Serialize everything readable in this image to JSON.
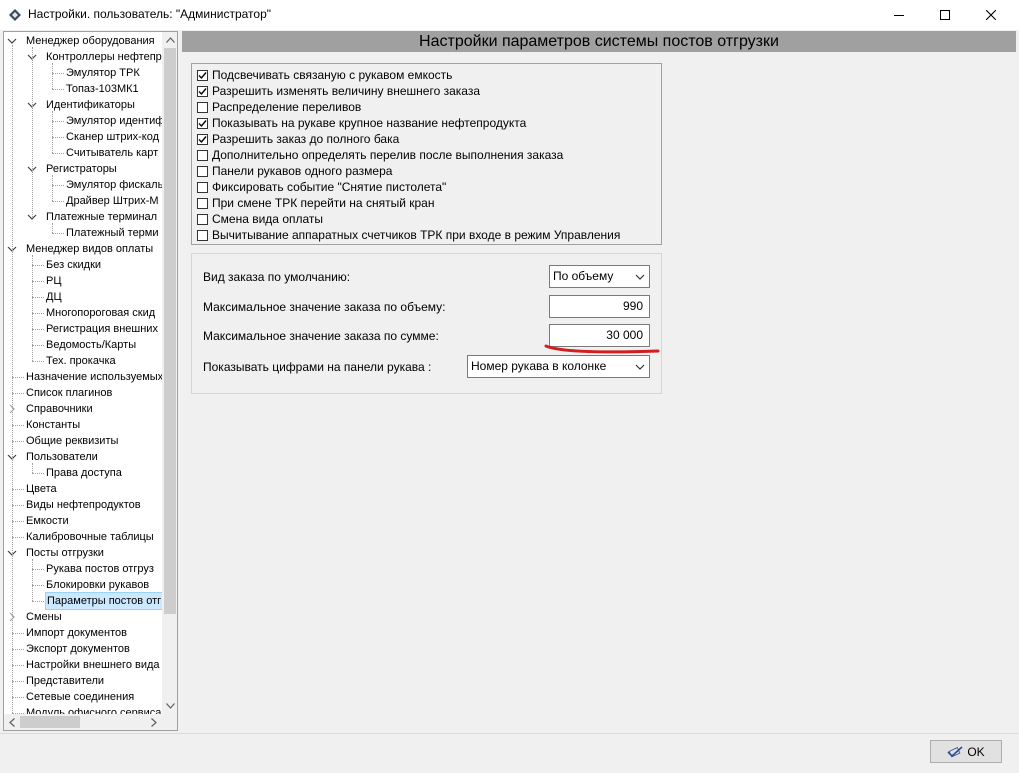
{
  "window": {
    "title": "Настройки. пользователь: \"Администратор\""
  },
  "tree": {
    "items": [
      {
        "label": "Менеджер оборудования",
        "level": 0,
        "expander": "expanded"
      },
      {
        "label": "Контроллеры нефтепр",
        "level": 1,
        "expander": "expanded"
      },
      {
        "label": "Эмулятор ТРК",
        "level": 2,
        "expander": "none"
      },
      {
        "label": "Топаз-103МК1",
        "level": 2,
        "expander": "none"
      },
      {
        "label": "Идентификаторы",
        "level": 1,
        "expander": "expanded"
      },
      {
        "label": "Эмулятор идентиф",
        "level": 2,
        "expander": "none"
      },
      {
        "label": "Сканер штрих-код",
        "level": 2,
        "expander": "none"
      },
      {
        "label": "Считыватель карт",
        "level": 2,
        "expander": "none"
      },
      {
        "label": "Регистраторы",
        "level": 1,
        "expander": "expanded"
      },
      {
        "label": "Эмулятор фискаль",
        "level": 2,
        "expander": "none"
      },
      {
        "label": "Драйвер Штрих-М",
        "level": 2,
        "expander": "none"
      },
      {
        "label": "Платежные терминал",
        "level": 1,
        "expander": "expanded"
      },
      {
        "label": "Платежный терми",
        "level": 2,
        "expander": "none"
      },
      {
        "label": "Менеджер видов оплаты",
        "level": 0,
        "expander": "expanded"
      },
      {
        "label": "Без скидки",
        "level": 1,
        "expander": "none"
      },
      {
        "label": "РЦ",
        "level": 1,
        "expander": "none"
      },
      {
        "label": "ДЦ",
        "level": 1,
        "expander": "none"
      },
      {
        "label": "Многопороговая скид",
        "level": 1,
        "expander": "none"
      },
      {
        "label": "Регистрация внешних",
        "level": 1,
        "expander": "none"
      },
      {
        "label": "Ведомость/Карты",
        "level": 1,
        "expander": "none"
      },
      {
        "label": "Тех. прокачка",
        "level": 1,
        "expander": "none"
      },
      {
        "label": "Назначение используемых",
        "level": 0,
        "expander": "none"
      },
      {
        "label": "Список плагинов",
        "level": 0,
        "expander": "none"
      },
      {
        "label": "Справочники",
        "level": 0,
        "expander": "collapsed"
      },
      {
        "label": "Константы",
        "level": 0,
        "expander": "none"
      },
      {
        "label": "Общие реквизиты",
        "level": 0,
        "expander": "none"
      },
      {
        "label": "Пользователи",
        "level": 0,
        "expander": "expanded"
      },
      {
        "label": "Права доступа",
        "level": 1,
        "expander": "none"
      },
      {
        "label": "Цвета",
        "level": 0,
        "expander": "none"
      },
      {
        "label": "Виды нефтепродуктов",
        "level": 0,
        "expander": "none"
      },
      {
        "label": "Емкости",
        "level": 0,
        "expander": "none"
      },
      {
        "label": "Калибровочные таблицы",
        "level": 0,
        "expander": "none"
      },
      {
        "label": "Посты отгрузки",
        "level": 0,
        "expander": "expanded"
      },
      {
        "label": "Рукава постов отгруз",
        "level": 1,
        "expander": "none"
      },
      {
        "label": "Блокировки рукавов",
        "level": 1,
        "expander": "none"
      },
      {
        "label": "Параметры постов отг",
        "level": 1,
        "expander": "none",
        "selected": true
      },
      {
        "label": "Смены",
        "level": 0,
        "expander": "collapsed"
      },
      {
        "label": "Импорт документов",
        "level": 0,
        "expander": "none"
      },
      {
        "label": "Экспорт документов",
        "level": 0,
        "expander": "none"
      },
      {
        "label": "Настройки внешнего вида",
        "level": 0,
        "expander": "none"
      },
      {
        "label": "Представители",
        "level": 0,
        "expander": "none"
      },
      {
        "label": "Сетевые соединения",
        "level": 0,
        "expander": "none"
      },
      {
        "label": "Модуль офисного сервиса",
        "level": 0,
        "expander": "none"
      }
    ]
  },
  "page": {
    "title": "Настройки параметров системы постов отгрузки"
  },
  "options": [
    {
      "label": "Подсвечивать связаную с рукавом емкость",
      "checked": true
    },
    {
      "label": "Разрешить изменять величину внешнего заказа",
      "checked": true
    },
    {
      "label": "Распределение переливов",
      "checked": false
    },
    {
      "label": "Показывать на рукаве крупное название нефтепродукта",
      "checked": true
    },
    {
      "label": "Разрешить заказ до полного бака",
      "checked": true
    },
    {
      "label": "Дополнительно определять перелив после выполнения заказа",
      "checked": false
    },
    {
      "label": "Панели рукавов одного размера",
      "checked": false
    },
    {
      "label": "Фиксировать событие \"Снятие пистолета\"",
      "checked": false
    },
    {
      "label": "При смене ТРК перейти на снятый кран",
      "checked": false
    },
    {
      "label": "Смена вида оплаты",
      "checked": false
    },
    {
      "label": "Вычитывание аппаратных счетчиков ТРК при входе в режим Управления",
      "checked": false
    }
  ],
  "settings": {
    "order_type_label": "Вид заказа по умолчанию:",
    "order_type_value": "По объему",
    "max_volume_label": "Максимальное значение заказа по объему:",
    "max_volume_value": "990",
    "max_sum_label": "Максимальное значение заказа по сумме:",
    "max_sum_value": "30 000",
    "digits_label": "Показывать цифрами на панели рукава :",
    "digits_value": "Номер рукава в колонке"
  },
  "footer": {
    "ok_label": "OK"
  },
  "colors": {
    "header_band": "#a0a0a0",
    "highlight_underline": "#d11f1f",
    "selection": "#cce8ff"
  }
}
